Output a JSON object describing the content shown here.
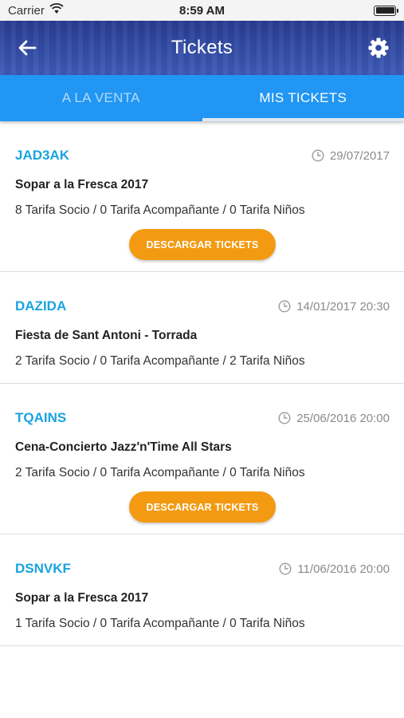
{
  "status_bar": {
    "carrier": "Carrier",
    "time": "8:59 AM",
    "icons": [
      "wifi-icon",
      "battery-icon"
    ]
  },
  "header": {
    "title": "Tickets",
    "back_icon": "arrow-left-icon",
    "settings_icon": "gear-icon"
  },
  "tabs": [
    {
      "label": "A LA VENTA",
      "active": false
    },
    {
      "label": "MIS TICKETS",
      "active": true
    }
  ],
  "tickets": [
    {
      "code": "JAD3AK",
      "date": "29/07/2017",
      "event": "Sopar a la Fresca 2017",
      "rates": "8 Tarifa Socio / 0 Tarifa Acompañante / 0 Tarifa Niños",
      "download_label": "DESCARGAR TICKETS"
    },
    {
      "code": "DAZIDA",
      "date": "14/01/2017 20:30",
      "event": "Fiesta de Sant Antoni - Torrada",
      "rates": "2 Tarifa Socio / 0 Tarifa Acompañante / 2 Tarifa Niños"
    },
    {
      "code": "TQAINS",
      "date": "25/06/2016 20:00",
      "event": "Cena-Concierto Jazz'n'Time All Stars",
      "rates": "2 Tarifa Socio / 0 Tarifa Acompañante / 0 Tarifa Niños",
      "download_label": "DESCARGAR TICKETS"
    },
    {
      "code": "DSNVKF",
      "date": "11/06/2016 20:00",
      "event": "Sopar a la Fresca 2017",
      "rates": "1 Tarifa Socio / 0 Tarifa Acompañante / 0 Tarifa Niños"
    }
  ],
  "colors": {
    "nav": "#2e4aa8",
    "tabs": "#2196f3",
    "code": "#1aa3e0",
    "button": "#f39a12"
  }
}
